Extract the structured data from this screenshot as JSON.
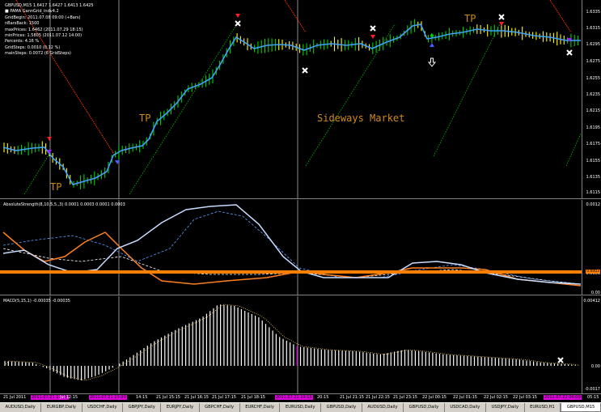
{
  "main_info": [
    "GBPUSD,M15  1.6417 1.6427 1.6413 1.6425",
    "■  PAMA GannGrid_indv4.2",
    "GridBegin: 2011.07.08 09:00  (+Bars)",
    "nBarsBack: 1500",
    "maxPrices: 1.6462  (2011.07.29 18:15)",
    "minPrices: 1.5805  (2011.07.12 14:00)",
    "Percents: 4.16 %",
    "GridSteps: 0.0010  (0.12 %)",
    "mainSteps: 0.0072  (6 GridSteps)"
  ],
  "price_ticks": [
    "1.6335",
    "1.6315",
    "1.6295",
    "1.6275",
    "1.6255",
    "1.6235",
    "1.6215",
    "1.6195",
    "1.6175",
    "1.6155",
    "1.6135",
    "1.6115"
  ],
  "annotations": {
    "tp_1": "TP",
    "tp_2": "TP",
    "tp_3": "TP",
    "sideways": "Sideways Market"
  },
  "ind1": {
    "label": "AbsoluteStrength(8,10,5,5,,3) 0.0001 0.0003 0.0001 0.0003",
    "ticks": [
      "0.0012",
      "0.0003",
      "0.00"
    ],
    "level_box": "0.0003"
  },
  "ind2": {
    "label": "MACD(5,15,1) -0.00035 -0.00035",
    "ticks": [
      "0.00412",
      "0.00",
      "-0.0017"
    ]
  },
  "time_labels": [
    {
      "t": "21 Jul 2011",
      "hl": false
    },
    {
      "t": "2011.07.21 11:25",
      "hl": true
    },
    {
      "t": "Jul 12:15",
      "hl": false
    },
    {
      "t": "2011.07.21 13:30",
      "hl": true
    },
    {
      "t": "14:15",
      "hl": false
    },
    {
      "t": "21 Jul 15:15",
      "hl": false
    },
    {
      "t": "21 Jul 16:15",
      "hl": false
    },
    {
      "t": "21 Jul 17:15",
      "hl": false
    },
    {
      "t": "21 Jul 18:15",
      "hl": false
    },
    {
      "t": "2011.07.21 19:15",
      "hl": true
    },
    {
      "t": "20:15",
      "hl": false
    },
    {
      "t": "21 Jul 21:15",
      "hl": false
    },
    {
      "t": "21 Jul 22:15",
      "hl": false
    },
    {
      "t": "21 Jul 23:15",
      "hl": false
    },
    {
      "t": "22 Jul 00:15",
      "hl": false
    },
    {
      "t": "22 Jul 01:15",
      "hl": false
    },
    {
      "t": "22 Jul 02:15",
      "hl": false
    },
    {
      "t": "22 Jul 03:15",
      "hl": false
    },
    {
      "t": "2011.07.22 04:00",
      "hl": true
    },
    {
      "t": "05:15",
      "hl": false
    }
  ],
  "tabs": [
    {
      "label": "AUDUSD,Daily",
      "active": false
    },
    {
      "label": "EURGBP,Daily",
      "active": false
    },
    {
      "label": "USDCHF,Daily",
      "active": false
    },
    {
      "label": "GBPJPY,Daily",
      "active": false
    },
    {
      "label": "EURJPY,Daily",
      "active": false
    },
    {
      "label": "GBPCHF,Daily",
      "active": false
    },
    {
      "label": "EURCHF,Daily",
      "active": false
    },
    {
      "label": "EURUSD,Daily",
      "active": false
    },
    {
      "label": "GBPUSD,Daily",
      "active": false
    },
    {
      "label": "AUDUSD,Daily",
      "active": false
    },
    {
      "label": "GBPUSD,Daily",
      "active": false
    },
    {
      "label": "USDCAD,Daily",
      "active": false
    },
    {
      "label": "USDJPY,Daily",
      "active": false
    },
    {
      "label": "EURUSD,H1",
      "active": false
    },
    {
      "label": "GBPUSD,M15",
      "active": true
    }
  ],
  "colors": {
    "bull_bar": "#00d000",
    "bear_bar": "#ffff00",
    "ma": "#3fa0ff",
    "grid_down": "#ff3000",
    "grid_up": "#00c000",
    "as_bull": "#c8dcff",
    "as_bear": "#ff8020",
    "level": "#ff8000",
    "macd_hist": "#ffffff",
    "macd_signal": "#ffcc66",
    "highlight": "#e000e0"
  },
  "tp_label_color": "#d08a1a"
}
